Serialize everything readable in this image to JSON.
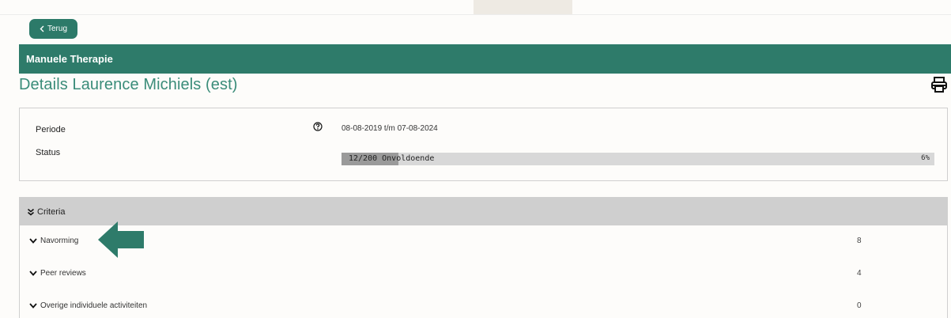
{
  "back_button": {
    "label": "Terug"
  },
  "header": {
    "title": "Manuele Therapie"
  },
  "page": {
    "title": "Details Laurence Michiels (est)"
  },
  "info": {
    "periode_label": "Periode",
    "periode_value": "08-08-2019 t/m 07-08-2024",
    "status_label": "Status",
    "progress_text": "12/200 Onvoldoende",
    "progress_percent": "6%",
    "progress_fraction": 0.06
  },
  "criteria": {
    "header_label": "Criteria",
    "items": [
      {
        "label": "Navorming",
        "count": "8"
      },
      {
        "label": "Peer reviews",
        "count": "4"
      },
      {
        "label": "Overige individuele activiteiten",
        "count": "0"
      }
    ]
  },
  "colors": {
    "accent": "#2e7b6a",
    "title": "#3a8c79",
    "progress_fill": "#9a9a9a",
    "progress_track": "#d8d8d8",
    "criteria_header": "#cfcfcf"
  },
  "icons": {
    "back": "chevron-left-icon",
    "print": "printer-icon",
    "help": "question-circle-icon",
    "collapse": "double-chevron-down-icon",
    "expand": "chevron-down-icon",
    "pointer": "arrow-left-icon"
  }
}
